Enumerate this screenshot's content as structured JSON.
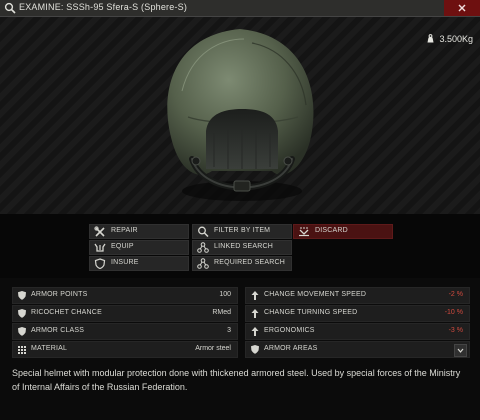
{
  "window": {
    "title": "EXAMINE: SSSh-95 Sfera-S (Sphere-S)",
    "weight": "3.500Kg"
  },
  "actions": {
    "repair": "REPAIR",
    "filter_by_item": "FILTER BY ITEM",
    "discard": "DISCARD",
    "equip": "EQUIP",
    "linked_search": "LINKED SEARCH",
    "insure": "INSURE",
    "required_search": "REQUIRED SEARCH"
  },
  "stats_left": [
    {
      "label": "ARMOR POINTS",
      "value": "100",
      "icon": "shield-icon"
    },
    {
      "label": "RICOCHET CHANCE",
      "value": "RMed",
      "icon": "shield-icon"
    },
    {
      "label": "ARMOR CLASS",
      "value": "3",
      "icon": "shield-icon"
    },
    {
      "label": "MATERIAL",
      "value": "Armor steel",
      "icon": "grid-icon"
    }
  ],
  "stats_right": [
    {
      "label": "CHANGE MOVEMENT SPEED",
      "value": "-2 %",
      "icon": "speed-icon"
    },
    {
      "label": "CHANGE TURNING SPEED",
      "value": "-10 %",
      "icon": "speed-icon"
    },
    {
      "label": "ERGONOMICS",
      "value": "-3 %",
      "icon": "speed-icon"
    },
    {
      "label": "ARMOR AREAS",
      "value": "",
      "icon": "shield-icon"
    }
  ],
  "description": "Special helmet with modular protection done with thickened armored steel. Used by special forces of the Ministry of Internal Affairs of the Russian Federation.",
  "colors": {
    "negative": "#d04a3e",
    "discard_bg": "#4a1212",
    "close_bg": "#6e1010"
  }
}
